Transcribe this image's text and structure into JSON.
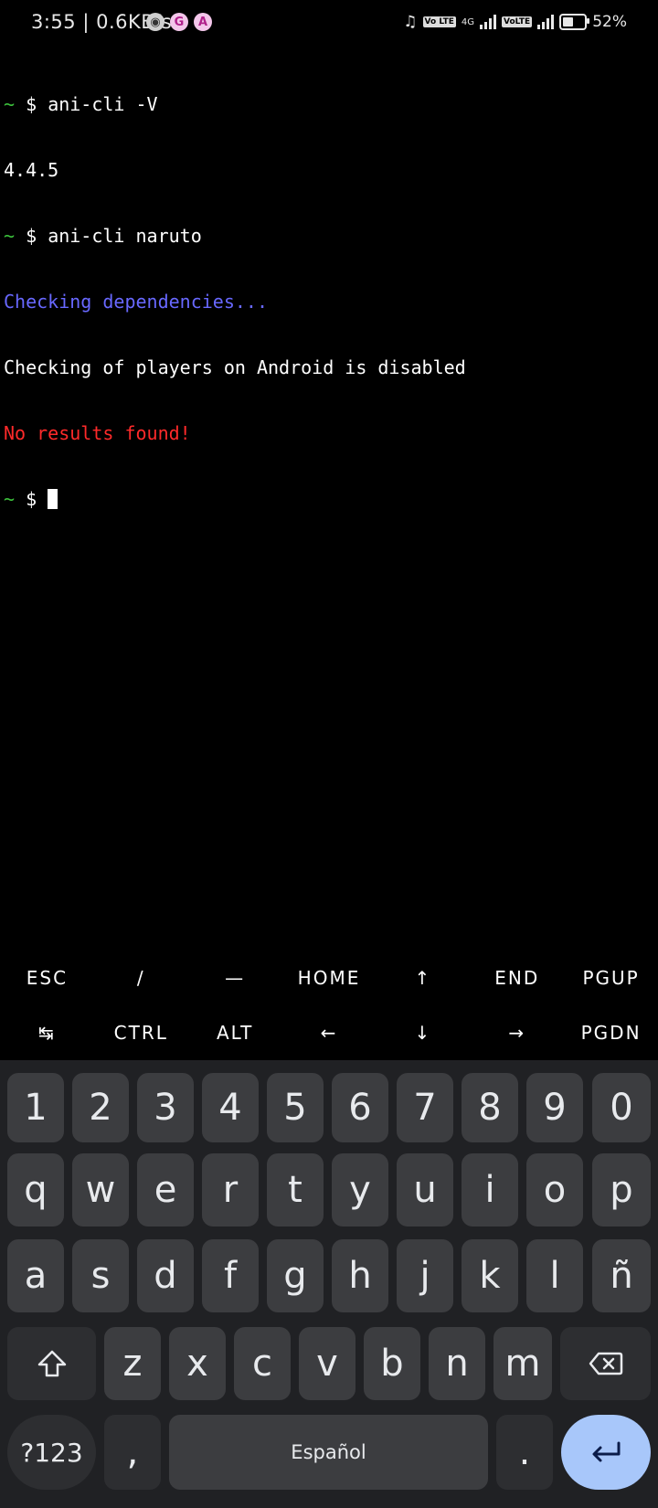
{
  "status_bar": {
    "time": "3:55",
    "net_speed": "0.6KB/s",
    "net_type": "4G",
    "volte_label": "Vo LTE",
    "battery_percent": "52%",
    "battery_level": 0.52
  },
  "terminal": {
    "prompt_symbol": "~",
    "dollar": "$",
    "line1_cmd": "ani-cli -V",
    "line2": "4.4.5",
    "line3_cmd": "ani-cli naruto",
    "line4": "Checking dependencies...",
    "line5": "Checking of players on Android is disabled",
    "line6": "No results found!",
    "colors": {
      "prompt": "#3cc23c",
      "info": "#6868ff",
      "error": "#ff2a2a"
    }
  },
  "extra_keys": {
    "row1": [
      "ESC",
      "/",
      "—",
      "HOME",
      "↑",
      "END",
      "PGUP"
    ],
    "row2": [
      "↹",
      "CTRL",
      "ALT",
      "←",
      "↓",
      "→",
      "PGDN"
    ]
  },
  "keyboard": {
    "numbers": [
      "1",
      "2",
      "3",
      "4",
      "5",
      "6",
      "7",
      "8",
      "9",
      "0"
    ],
    "row_q": [
      "q",
      "w",
      "e",
      "r",
      "t",
      "y",
      "u",
      "i",
      "o",
      "p"
    ],
    "row_a": [
      "a",
      "s",
      "d",
      "f",
      "g",
      "h",
      "j",
      "k",
      "l",
      "ñ"
    ],
    "row_z": [
      "z",
      "x",
      "c",
      "v",
      "b",
      "n",
      "m"
    ],
    "symbols_label": "?123",
    "comma": ",",
    "space_label": "Español",
    "period": ".",
    "shift_icon": "shift-icon",
    "backspace_icon": "backspace-icon",
    "enter_icon": "enter-icon"
  }
}
